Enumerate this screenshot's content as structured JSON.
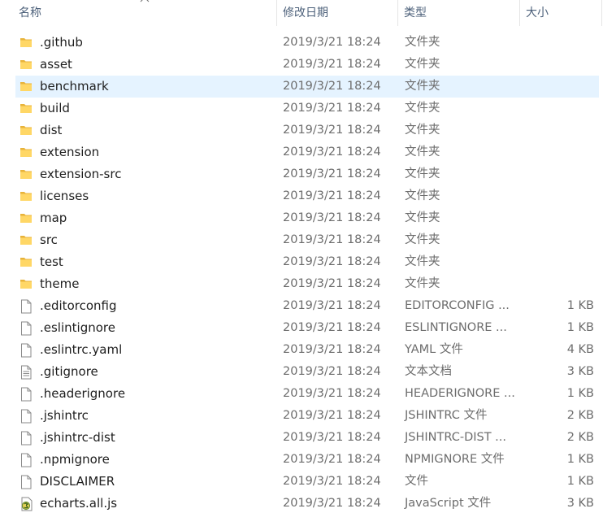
{
  "columns": {
    "name": "名称",
    "date": "修改日期",
    "type": "类型",
    "size": "大小"
  },
  "files": [
    {
      "name": ".github",
      "date": "2019/3/21 18:24",
      "type": "文件夹",
      "size": "",
      "icon": "folder-icon"
    },
    {
      "name": "asset",
      "date": "2019/3/21 18:24",
      "type": "文件夹",
      "size": "",
      "icon": "folder-icon"
    },
    {
      "name": "benchmark",
      "date": "2019/3/21 18:24",
      "type": "文件夹",
      "size": "",
      "icon": "folder-icon",
      "selected": true
    },
    {
      "name": "build",
      "date": "2019/3/21 18:24",
      "type": "文件夹",
      "size": "",
      "icon": "folder-icon"
    },
    {
      "name": "dist",
      "date": "2019/3/21 18:24",
      "type": "文件夹",
      "size": "",
      "icon": "folder-icon"
    },
    {
      "name": "extension",
      "date": "2019/3/21 18:24",
      "type": "文件夹",
      "size": "",
      "icon": "folder-icon"
    },
    {
      "name": "extension-src",
      "date": "2019/3/21 18:24",
      "type": "文件夹",
      "size": "",
      "icon": "folder-icon"
    },
    {
      "name": "licenses",
      "date": "2019/3/21 18:24",
      "type": "文件夹",
      "size": "",
      "icon": "folder-icon"
    },
    {
      "name": "map",
      "date": "2019/3/21 18:24",
      "type": "文件夹",
      "size": "",
      "icon": "folder-icon"
    },
    {
      "name": "src",
      "date": "2019/3/21 18:24",
      "type": "文件夹",
      "size": "",
      "icon": "folder-icon"
    },
    {
      "name": "test",
      "date": "2019/3/21 18:24",
      "type": "文件夹",
      "size": "",
      "icon": "folder-icon"
    },
    {
      "name": "theme",
      "date": "2019/3/21 18:24",
      "type": "文件夹",
      "size": "",
      "icon": "folder-icon"
    },
    {
      "name": ".editorconfig",
      "date": "2019/3/21 18:24",
      "type": "EDITORCONFIG ...",
      "size": "1 KB",
      "icon": "file-icon"
    },
    {
      "name": ".eslintignore",
      "date": "2019/3/21 18:24",
      "type": "ESLINTIGNORE ...",
      "size": "1 KB",
      "icon": "file-icon"
    },
    {
      "name": ".eslintrc.yaml",
      "date": "2019/3/21 18:24",
      "type": "YAML 文件",
      "size": "4 KB",
      "icon": "file-icon"
    },
    {
      "name": ".gitignore",
      "date": "2019/3/21 18:24",
      "type": "文本文档",
      "size": "3 KB",
      "icon": "text-file-icon"
    },
    {
      "name": ".headerignore",
      "date": "2019/3/21 18:24",
      "type": "HEADERIGNORE ...",
      "size": "1 KB",
      "icon": "file-icon"
    },
    {
      "name": ".jshintrc",
      "date": "2019/3/21 18:24",
      "type": "JSHINTRC 文件",
      "size": "2 KB",
      "icon": "file-icon"
    },
    {
      "name": ".jshintrc-dist",
      "date": "2019/3/21 18:24",
      "type": "JSHINTRC-DIST ...",
      "size": "2 KB",
      "icon": "file-icon"
    },
    {
      "name": ".npmignore",
      "date": "2019/3/21 18:24",
      "type": "NPMIGNORE 文件",
      "size": "1 KB",
      "icon": "file-icon"
    },
    {
      "name": "DISCLAIMER",
      "date": "2019/3/21 18:24",
      "type": "文件",
      "size": "1 KB",
      "icon": "file-icon"
    },
    {
      "name": "echarts.all.js",
      "date": "2019/3/21 18:24",
      "type": "JavaScript 文件",
      "size": "3 KB",
      "icon": "js-file-icon"
    }
  ],
  "colors": {
    "selected_row": "#e5f3ff",
    "folder": "#f0c24d",
    "header_text": "#4c607a"
  }
}
